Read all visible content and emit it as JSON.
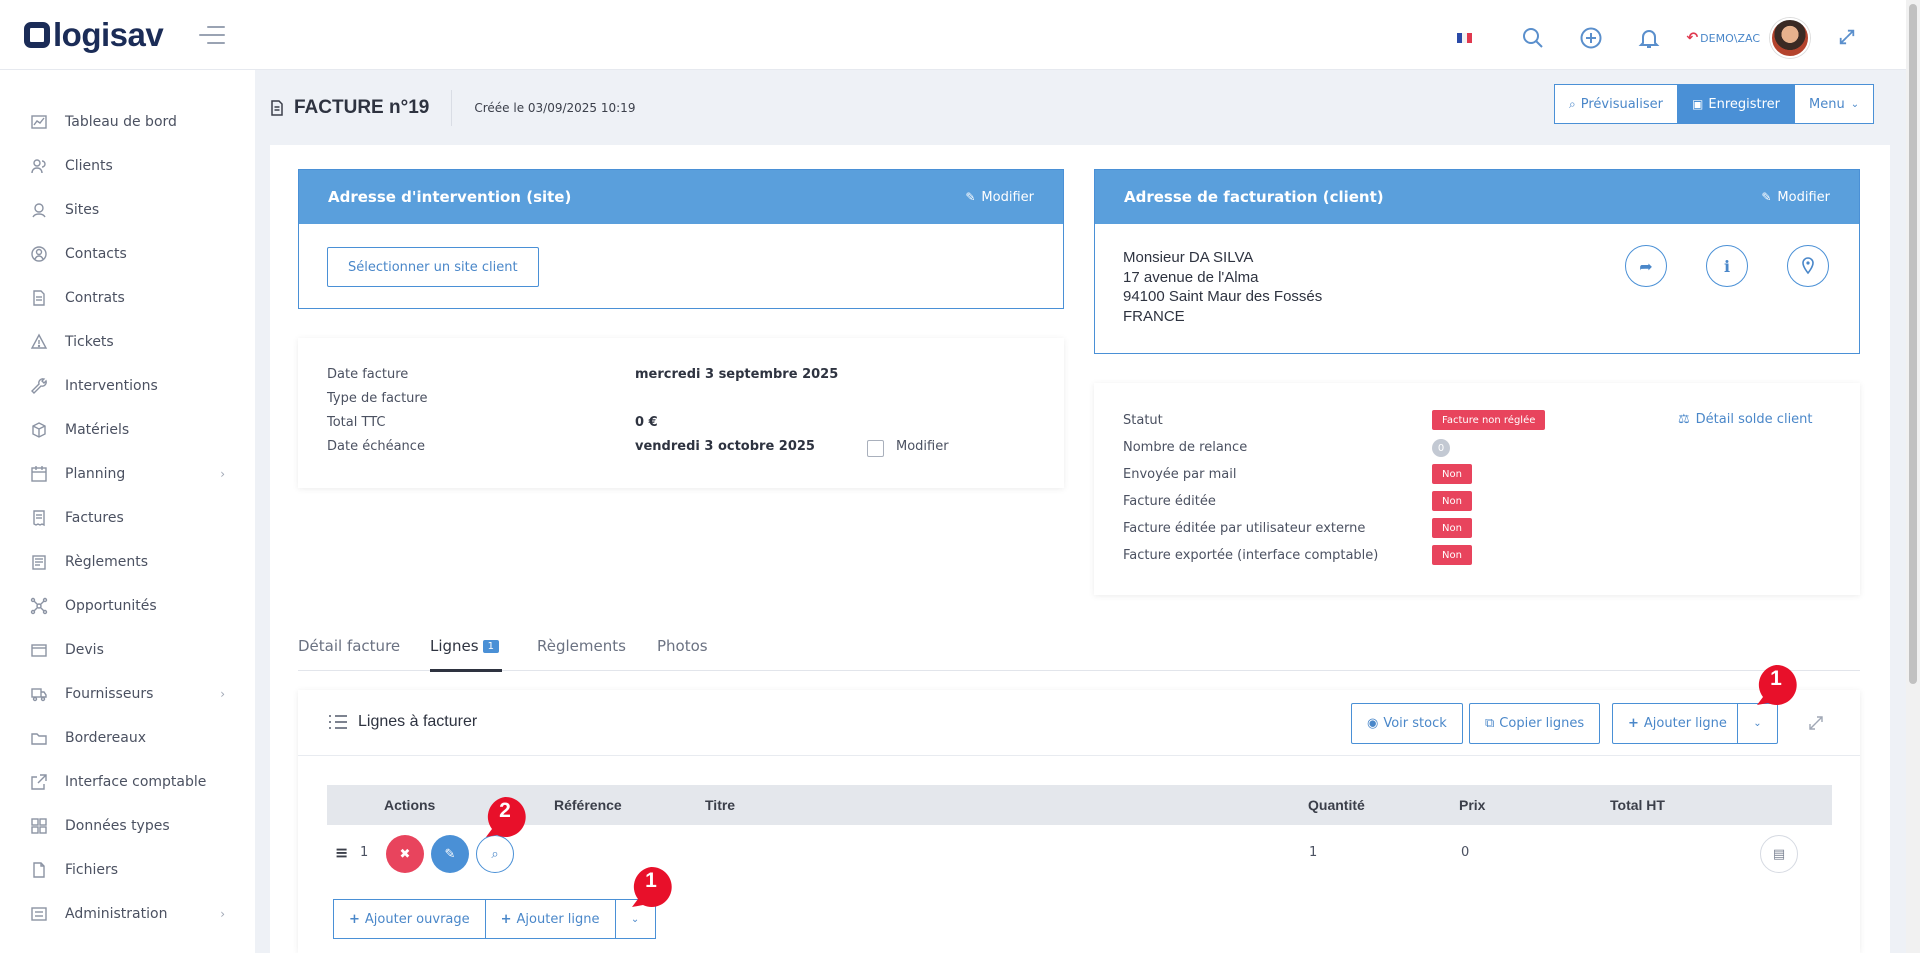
{
  "app": {
    "logo_text": "logisav"
  },
  "topbar": {
    "user": "DEMO\\ZAC",
    "flag_colors": [
      "#2a4aa8",
      "#ffffff",
      "#e0394f"
    ]
  },
  "sidebar": {
    "items": [
      {
        "label": "Tableau de bord",
        "icon": "chart-icon"
      },
      {
        "label": "Clients",
        "icon": "users-icon"
      },
      {
        "label": "Sites",
        "icon": "location-icon"
      },
      {
        "label": "Contacts",
        "icon": "contact-icon"
      },
      {
        "label": "Contrats",
        "icon": "contract-icon"
      },
      {
        "label": "Tickets",
        "icon": "warning-icon"
      },
      {
        "label": "Interventions",
        "icon": "wrench-icon"
      },
      {
        "label": "Matériels",
        "icon": "cube-icon"
      },
      {
        "label": "Planning",
        "icon": "calendar-icon",
        "has_children": true
      },
      {
        "label": "Factures",
        "icon": "invoice-icon"
      },
      {
        "label": "Règlements",
        "icon": "payment-icon"
      },
      {
        "label": "Opportunités",
        "icon": "network-icon"
      },
      {
        "label": "Devis",
        "icon": "quote-icon"
      },
      {
        "label": "Fournisseurs",
        "icon": "truck-icon",
        "has_children": true
      },
      {
        "label": "Bordereaux",
        "icon": "folder-icon"
      },
      {
        "label": "Interface comptable",
        "icon": "export-icon"
      },
      {
        "label": "Données types",
        "icon": "grid-icon"
      },
      {
        "label": "Fichiers",
        "icon": "file-icon"
      },
      {
        "label": "Administration",
        "icon": "settings-icon",
        "has_children": true
      }
    ]
  },
  "header": {
    "title": "FACTURE n°19",
    "created": "Créée le 03/09/2025 10:19",
    "preview_label": "Prévisualiser",
    "save_label": "Enregistrer",
    "menu_label": "Menu"
  },
  "intervention_address": {
    "title": "Adresse d'intervention (site)",
    "modify_label": "Modifier",
    "select_site_label": "Sélectionner un site client"
  },
  "billing_address": {
    "title": "Adresse de facturation (client)",
    "modify_label": "Modifier",
    "lines": [
      "Monsieur DA SILVA",
      "17 avenue de l'Alma",
      "94100 Saint Maur des Fossés",
      "FRANCE"
    ]
  },
  "invoice_info": {
    "date_label": "Date facture",
    "date_value": "mercredi 3 septembre 2025",
    "type_label": "Type de facture",
    "total_label": "Total TTC",
    "total_value": "0 €",
    "due_label": "Date échéance",
    "due_value": "vendredi 3 octobre 2025",
    "modify_label": "Modifier"
  },
  "status_info": {
    "status_label": "Statut",
    "status_value": "Facture non réglée",
    "reminders_label": "Nombre de relance",
    "reminders_value": "0",
    "sent_label": "Envoyée par mail",
    "sent_value": "Non",
    "edited_label": "Facture éditée",
    "edited_value": "Non",
    "edited_ext_label": "Facture éditée par utilisateur externe",
    "edited_ext_value": "Non",
    "exported_label": "Facture exportée (interface comptable)",
    "exported_value": "Non",
    "balance_link": "Détail solde client"
  },
  "tabs": [
    {
      "label": "Détail facture"
    },
    {
      "label": "Lignes",
      "badge": "1"
    },
    {
      "label": "Règlements"
    },
    {
      "label": "Photos"
    }
  ],
  "lines_section": {
    "title": "Lignes à facturer",
    "stock_label": "Voir stock",
    "copy_label": "Copier lignes",
    "add_line_label": "Ajouter ligne",
    "columns": [
      "Actions",
      "Référence",
      "Titre",
      "Quantité",
      "Prix",
      "Total HT"
    ],
    "rows": [
      {
        "index": "1",
        "quantity": "1",
        "price": "0"
      }
    ],
    "add_work_label": "Ajouter ouvrage",
    "add_line_bottom_label": "Ajouter ligne"
  },
  "markers": [
    "1",
    "2",
    "1"
  ]
}
